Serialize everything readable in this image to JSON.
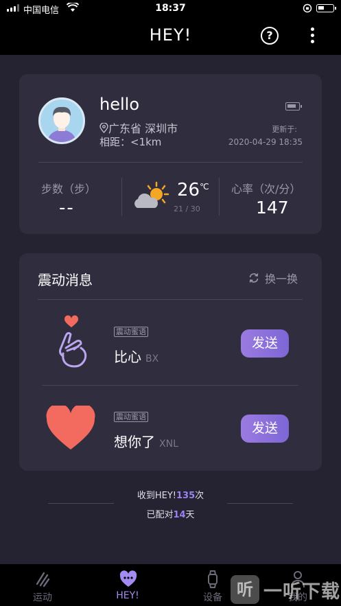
{
  "status_bar": {
    "carrier": "中国电信",
    "time": "18:37"
  },
  "header": {
    "title": "HEY!"
  },
  "profile": {
    "name": "hello",
    "location": "广东省 深圳市",
    "distance": "相距：<1km",
    "updated_label": "更新于:",
    "updated_time": "2020-04-29 18:35"
  },
  "stats": {
    "steps_label": "步数（步）",
    "steps_value": "--",
    "temperature": "26",
    "temperature_unit": "℃",
    "temp_range": "21 / 30",
    "heart_rate_label": "心率（次/分）",
    "heart_rate_value": "147"
  },
  "vibration": {
    "title": "震动消息",
    "refresh_label": "换一换",
    "messages": [
      {
        "tag": "震动蜜语",
        "text": "比心",
        "code": "BX",
        "send_label": "发送",
        "icon": "finger-heart-icon"
      },
      {
        "tag": "震动蜜语",
        "text": "想你了",
        "code": "XNL",
        "send_label": "发送",
        "icon": "heart-icon"
      }
    ]
  },
  "summary": {
    "received_prefix": "收到HEY!",
    "received_count": "135",
    "received_suffix": "次",
    "paired_prefix": "已配对",
    "paired_days": "14",
    "paired_suffix": "天"
  },
  "tabs": [
    {
      "label": "运动",
      "active": false
    },
    {
      "label": "HEY!",
      "active": true
    },
    {
      "label": "设备",
      "active": false
    },
    {
      "label": "我的",
      "active": false
    }
  ],
  "watermark": {
    "logo_char": "听",
    "text": "一听下载"
  },
  "colors": {
    "background": "#252232",
    "card": "#302d3f",
    "accent": "#9b83f2",
    "heart": "#f26b5e"
  }
}
